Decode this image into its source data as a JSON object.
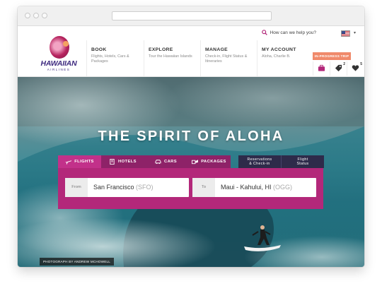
{
  "utility": {
    "help_text": "How can we help you?"
  },
  "logo": {
    "word": "HAWAIIAN",
    "sub": "AIRLINES"
  },
  "nav": {
    "items": [
      {
        "heading": "BOOK",
        "sub": "Flights, Hotels, Cars & Packages"
      },
      {
        "heading": "EXPLORE",
        "sub": "Tour the Hawaiian Islands"
      },
      {
        "heading": "MANAGE",
        "sub": "Check-in, Flight Status & Itineraries"
      },
      {
        "heading": "MY ACCOUNT",
        "sub": "Aloha, Charlie B."
      }
    ],
    "trip_button": "IN-PROGRESS TRIP",
    "icons": [
      {
        "name": "briefcase-icon",
        "count": ""
      },
      {
        "name": "tag-icon",
        "count": "2"
      },
      {
        "name": "heart-icon",
        "count": "5"
      }
    ]
  },
  "hero": {
    "headline": "THE SPIRIT OF ALOHA",
    "credit": "PHOTOGRAPH BY ANDREW MCHOWELL"
  },
  "booking": {
    "tabs": [
      {
        "label": "FLIGHTS",
        "active": true
      },
      {
        "label": "HOTELS",
        "active": false
      },
      {
        "label": "CARS",
        "active": false
      },
      {
        "label": "PACKAGES",
        "active": false
      }
    ],
    "side_tabs": [
      {
        "line1": "Reservations",
        "line2": "& Check-in"
      },
      {
        "line1": "Flight",
        "line2": "Status"
      }
    ],
    "from": {
      "label": "From",
      "value": "San Francisco",
      "code": "(SFO)"
    },
    "to": {
      "label": "To",
      "value": "Maui - Kahului, HI",
      "code": "(OGG)"
    }
  },
  "colors": {
    "brand_purple": "#3e2a7f",
    "booking_magenta": "#b3287a",
    "tab_active": "#c2318a",
    "tab_inactive": "#8e2268",
    "side_tab": "#2e2b4a",
    "trip_button": "#f08a6b"
  }
}
